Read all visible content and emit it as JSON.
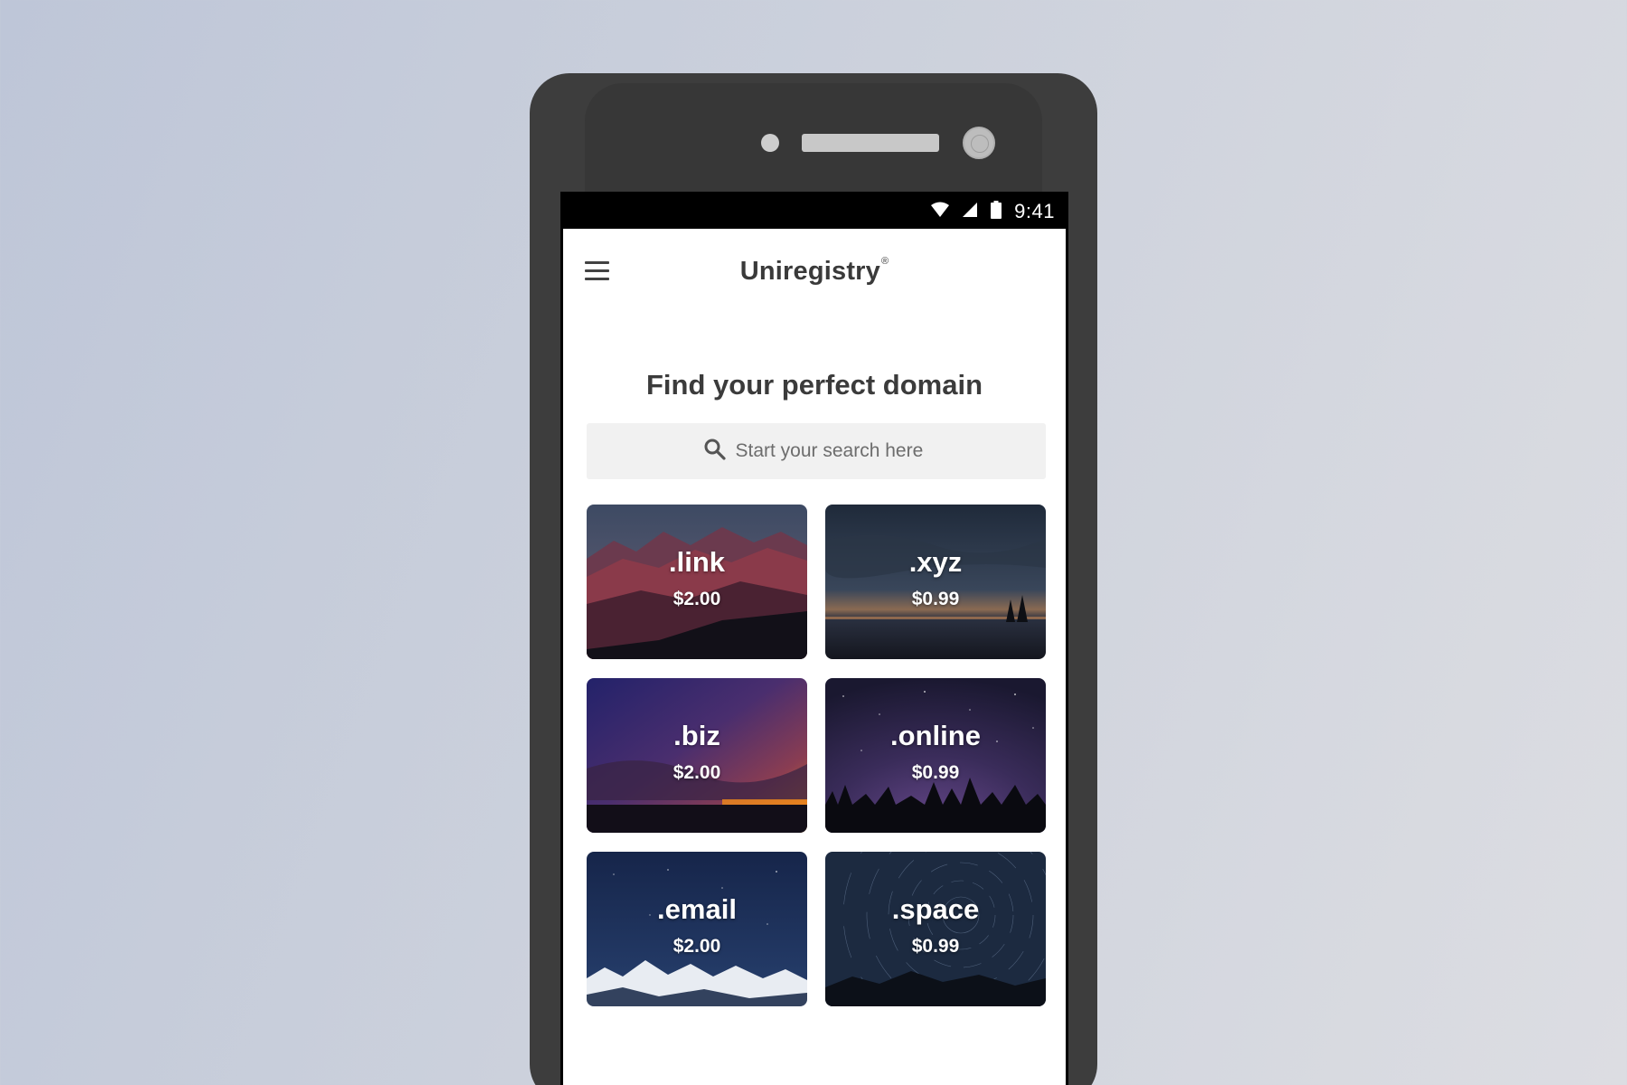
{
  "status_bar": {
    "time": "9:41",
    "icons": [
      "wifi-icon",
      "cell-signal-icon",
      "battery-icon"
    ]
  },
  "app_bar": {
    "menu_icon": "hamburger-menu-icon",
    "brand": "Uniregistry",
    "brand_mark": "®"
  },
  "main": {
    "headline": "Find your perfect domain",
    "search": {
      "icon": "search-icon",
      "placeholder": "Start your search here",
      "value": ""
    },
    "domains": [
      {
        "name": ".link",
        "price": "$2.00",
        "background": "red-mountain-range-photo"
      },
      {
        "name": ".xyz",
        "price": "$0.99",
        "background": "dusk-lake-horizon-photo"
      },
      {
        "name": ".biz",
        "price": "$2.00",
        "background": "purple-orange-sunset-clouds-photo"
      },
      {
        "name": ".online",
        "price": "$0.99",
        "background": "starry-sky-forest-silhouette-photo"
      },
      {
        "name": ".email",
        "price": "$2.00",
        "background": "night-sky-snowy-mountains-photo"
      },
      {
        "name": ".space",
        "price": "$0.99",
        "background": "star-trails-photo"
      }
    ]
  },
  "colors": {
    "background_gradient_start": "#bec6d8",
    "background_gradient_end": "#dcdde2",
    "phone_body": "#3d3d3d",
    "screen_background": "#ffffff",
    "search_background": "#f1f1f1",
    "text_primary": "#3b3b3b"
  }
}
